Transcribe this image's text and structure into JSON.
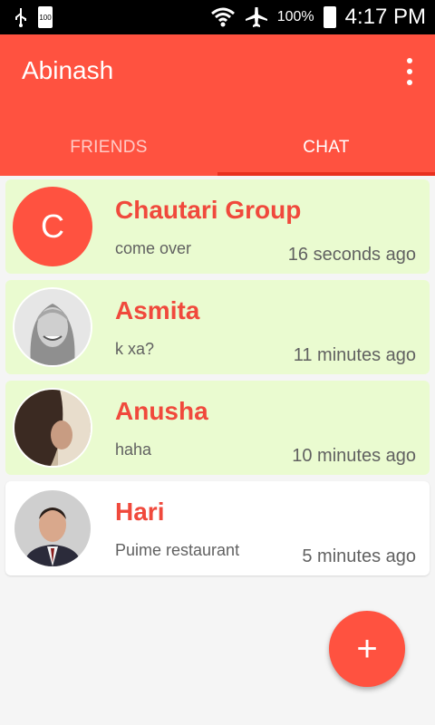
{
  "status_bar": {
    "battery_small": "100",
    "battery_percent": "100%",
    "time": "4:17 PM",
    "icons": [
      "usb-icon",
      "battery-icon",
      "wifi-icon",
      "airplane-icon",
      "battery-full-icon"
    ]
  },
  "app_bar": {
    "title": "Abinash",
    "color": "#ff5240"
  },
  "tabs": [
    {
      "label": "FRIENDS",
      "active": false
    },
    {
      "label": "CHAT",
      "active": true
    }
  ],
  "chats": [
    {
      "name": "Chautari Group",
      "message": "come over",
      "time": "16 seconds ago",
      "avatar_letter": "C",
      "unread": true
    },
    {
      "name": "Asmita",
      "message": "k xa?",
      "time": "11 minutes ago",
      "unread": true
    },
    {
      "name": "Anusha",
      "message": "haha",
      "time": "10 minutes ago",
      "unread": true
    },
    {
      "name": "Hari",
      "message": "Puime restaurant",
      "time": "5 minutes ago",
      "unread": false
    }
  ],
  "fab": {
    "label": "+"
  }
}
